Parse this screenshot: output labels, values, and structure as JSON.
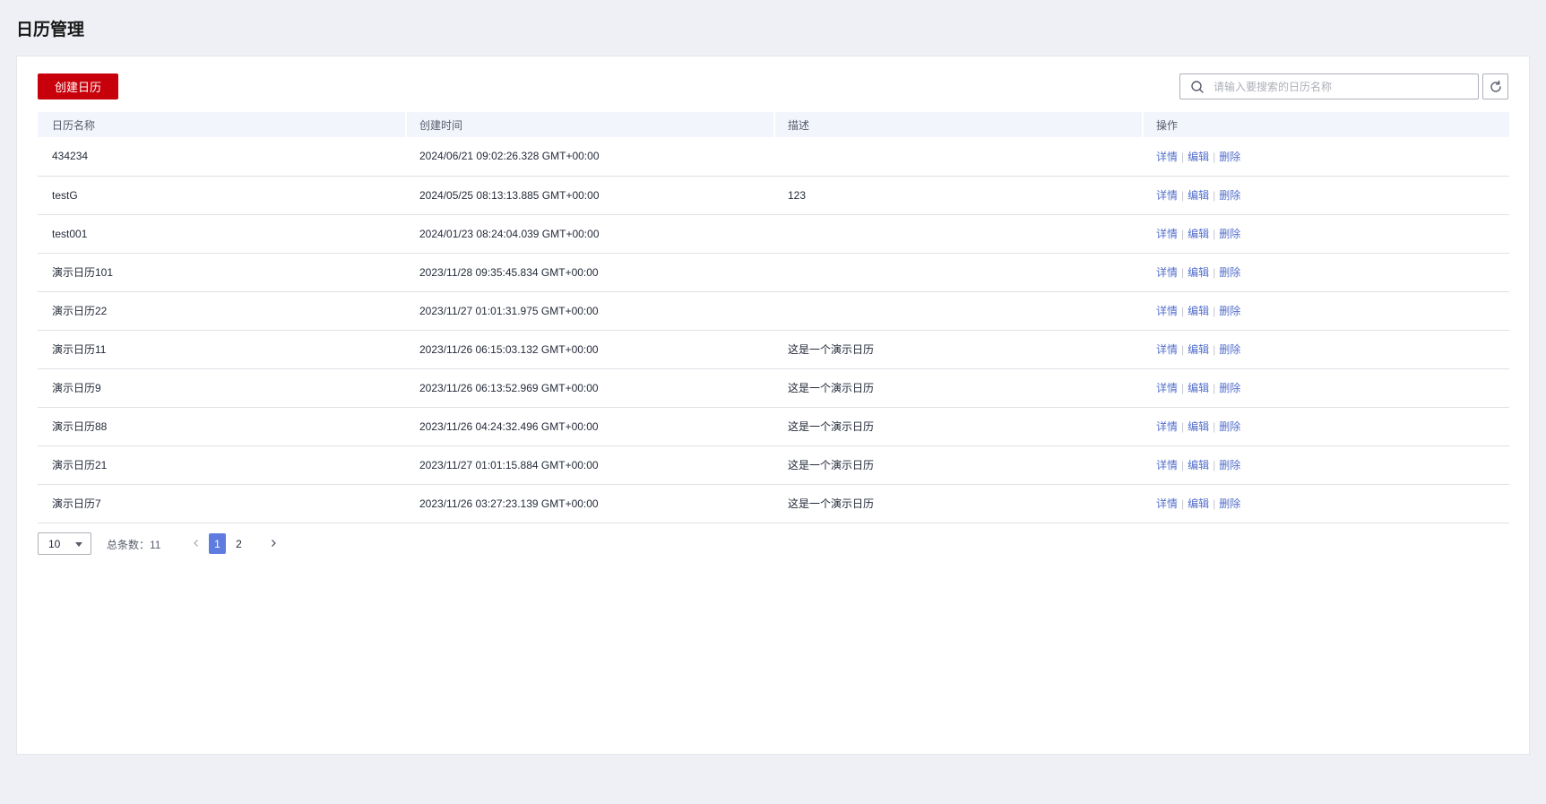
{
  "page": {
    "title": "日历管理"
  },
  "toolbar": {
    "create_label": "创建日历",
    "search_placeholder": "请输入要搜索的日历名称"
  },
  "table": {
    "headers": [
      "日历名称",
      "创建时间",
      "描述",
      "操作"
    ],
    "ops": {
      "detail": "详情",
      "edit": "编辑",
      "delete": "删除",
      "sep": "|"
    },
    "rows": [
      {
        "name": "434234",
        "created": "2024/06/21 09:02:26.328 GMT+00:00",
        "desc": ""
      },
      {
        "name": "testG",
        "created": "2024/05/25 08:13:13.885 GMT+00:00",
        "desc": "123"
      },
      {
        "name": "test001",
        "created": "2024/01/23 08:24:04.039 GMT+00:00",
        "desc": ""
      },
      {
        "name": "演示日历101",
        "created": "2023/11/28 09:35:45.834 GMT+00:00",
        "desc": ""
      },
      {
        "name": "演示日历22",
        "created": "2023/11/27 01:01:31.975 GMT+00:00",
        "desc": ""
      },
      {
        "name": "演示日历11",
        "created": "2023/11/26 06:15:03.132 GMT+00:00",
        "desc": "这是一个演示日历"
      },
      {
        "name": "演示日历9",
        "created": "2023/11/26 06:13:52.969 GMT+00:00",
        "desc": "这是一个演示日历"
      },
      {
        "name": "演示日历88",
        "created": "2023/11/26 04:24:32.496 GMT+00:00",
        "desc": "这是一个演示日历"
      },
      {
        "name": "演示日历21",
        "created": "2023/11/27 01:01:15.884 GMT+00:00",
        "desc": "这是一个演示日历"
      },
      {
        "name": "演示日历7",
        "created": "2023/11/26 03:27:23.139 GMT+00:00",
        "desc": "这是一个演示日历"
      }
    ]
  },
  "pager": {
    "page_size": "10",
    "total_text": "总条数：11",
    "current_page": "1",
    "next_page": "2"
  },
  "colors": {
    "primary_button": "#c7000b",
    "link": "#526ecc",
    "active_page": "#5e7ce0",
    "header_bg": "#f2f5fc"
  },
  "icons": {
    "search": "search-icon",
    "refresh": "refresh-icon",
    "prev": "chevron-left-icon",
    "next": "chevron-right-icon",
    "dropdown": "caret-down-icon"
  }
}
